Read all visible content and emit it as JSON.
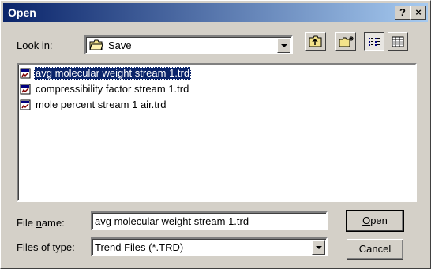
{
  "window": {
    "title": "Open"
  },
  "titlebar": {
    "help_label": "?",
    "close_label": "×"
  },
  "lookin": {
    "label_pre": "Look ",
    "label_mnemonic": "i",
    "label_post": "n:",
    "value": "Save"
  },
  "files": [
    {
      "name": "avg molecular weight stream 1.trd",
      "selected": true
    },
    {
      "name": "compressibility factor stream 1.trd",
      "selected": false
    },
    {
      "name": "mole percent stream 1 air.trd",
      "selected": false
    }
  ],
  "filename": {
    "label_pre": "File ",
    "label_mnemonic": "n",
    "label_post": "ame:",
    "value": "avg molecular weight stream 1.trd"
  },
  "filetype": {
    "label_pre": "Files of ",
    "label_mnemonic": "t",
    "label_post": "ype:",
    "value": "Trend Files (*.TRD)"
  },
  "buttons": {
    "open_mnemonic": "O",
    "open_rest": "pen",
    "cancel": "Cancel"
  },
  "colors": {
    "face": "#d4d0c8",
    "titlebar_start": "#0a246a",
    "titlebar_end": "#a6caf0",
    "selection": "#0a246a"
  }
}
